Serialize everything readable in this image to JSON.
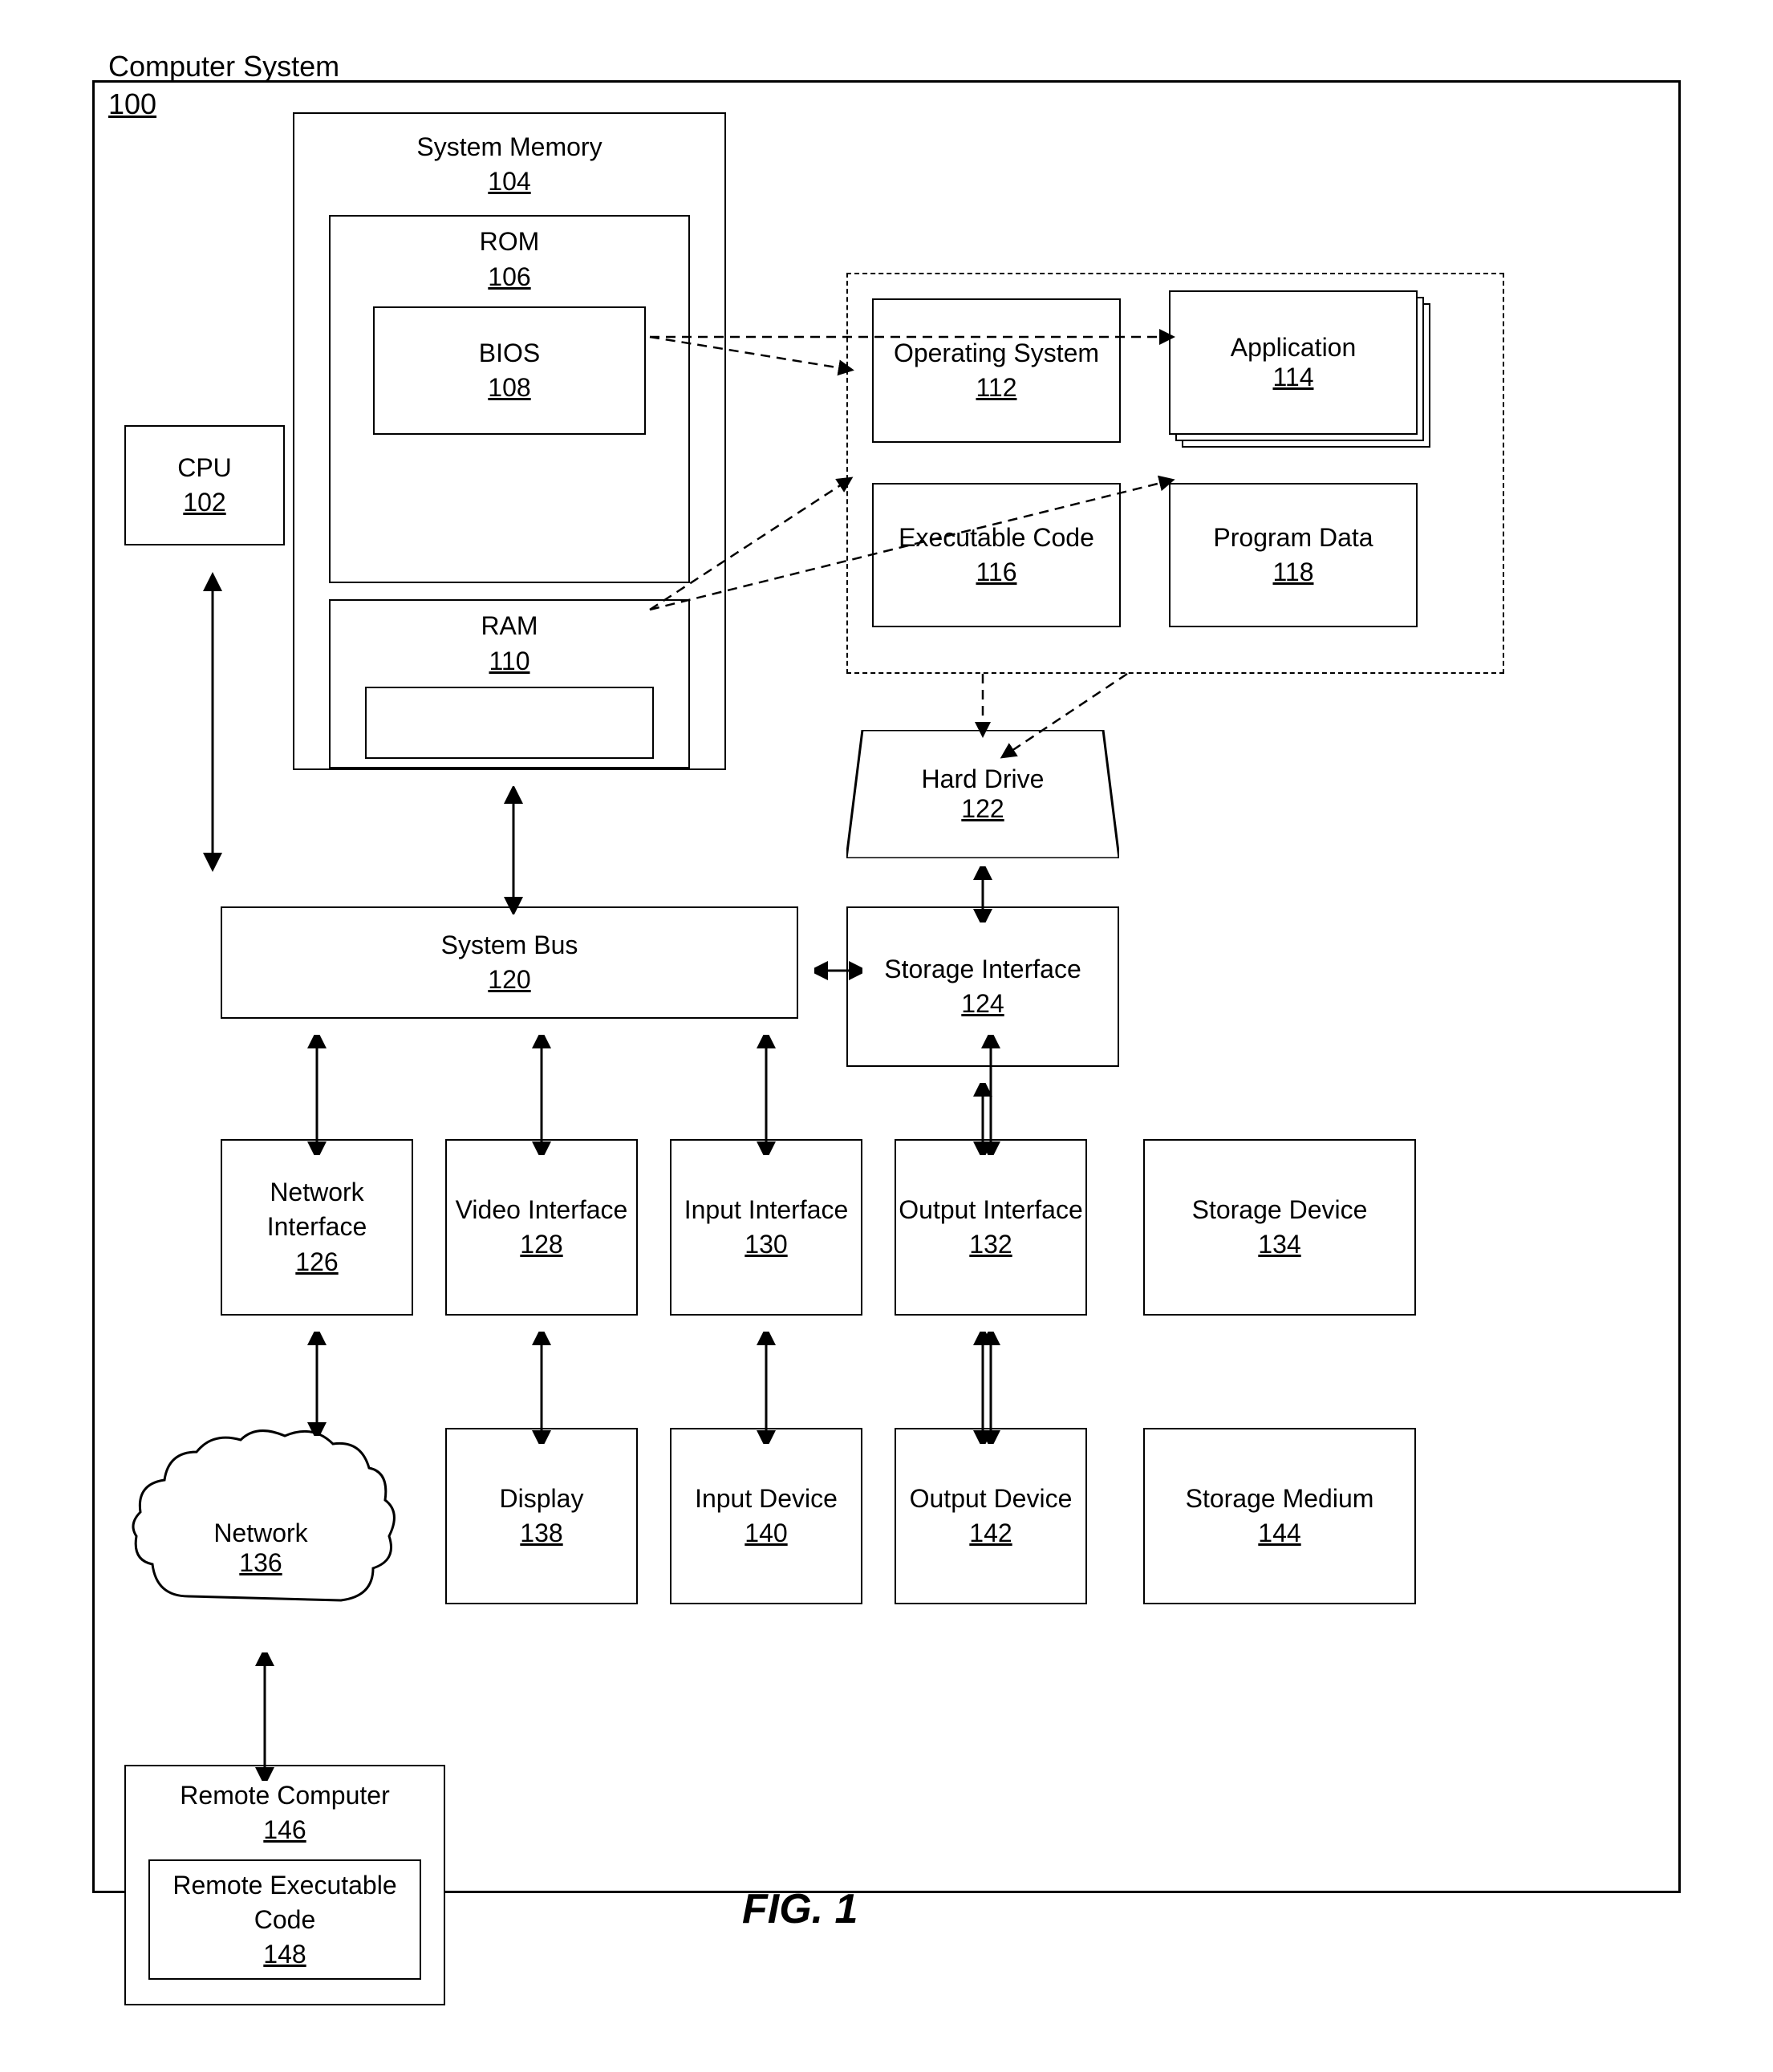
{
  "title": "FIG. 1",
  "components": {
    "computer_system": {
      "label": "Computer System",
      "num": "100"
    },
    "cpu": {
      "label": "CPU",
      "num": "102"
    },
    "system_memory": {
      "label": "System Memory",
      "num": "104"
    },
    "rom": {
      "label": "ROM",
      "num": "106"
    },
    "bios": {
      "label": "BIOS",
      "num": "108"
    },
    "ram": {
      "label": "RAM",
      "num": "110"
    },
    "os": {
      "label": "Operating System",
      "num": "112"
    },
    "application": {
      "label": "Application",
      "num": "114"
    },
    "executable_code": {
      "label": "Executable Code",
      "num": "116"
    },
    "program_data": {
      "label": "Program Data",
      "num": "118"
    },
    "system_bus": {
      "label": "System Bus",
      "num": "120"
    },
    "hard_drive": {
      "label": "Hard Drive",
      "num": "122"
    },
    "storage_interface": {
      "label": "Storage Interface",
      "num": "124"
    },
    "network_interface": {
      "label": "Network Interface",
      "num": "126"
    },
    "video_interface": {
      "label": "Video Interface",
      "num": "128"
    },
    "input_interface": {
      "label": "Input Interface",
      "num": "130"
    },
    "output_interface": {
      "label": "Output Interface",
      "num": "132"
    },
    "storage_device": {
      "label": "Storage Device",
      "num": "134"
    },
    "network": {
      "label": "Network",
      "num": "136"
    },
    "display": {
      "label": "Display",
      "num": "138"
    },
    "input_device": {
      "label": "Input Device",
      "num": "140"
    },
    "output_device": {
      "label": "Output Device",
      "num": "142"
    },
    "storage_medium": {
      "label": "Storage Medium",
      "num": "144"
    },
    "remote_computer": {
      "label": "Remote Computer",
      "num": "146"
    },
    "remote_executable_code": {
      "label": "Remote Executable Code",
      "num": "148"
    }
  }
}
